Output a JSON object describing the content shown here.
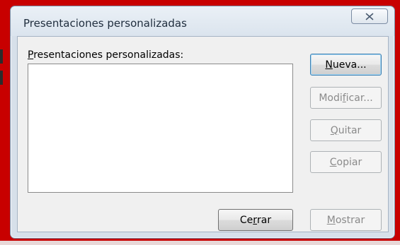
{
  "window": {
    "title": "Presentaciones personalizadas",
    "close_icon": "close-x-icon"
  },
  "list": {
    "label": {
      "before": "",
      "mnemonic": "P",
      "after": "resentaciones personalizadas:"
    },
    "items": []
  },
  "buttons": {
    "new": {
      "before": "",
      "mnemonic": "N",
      "after": "ueva...",
      "enabled": true
    },
    "edit": {
      "before": "Modi",
      "mnemonic": "f",
      "after": "icar...",
      "enabled": false
    },
    "remove": {
      "before": "",
      "mnemonic": "Q",
      "after": "uitar",
      "enabled": false
    },
    "copy": {
      "before": "",
      "mnemonic": "C",
      "after": "opiar",
      "enabled": false
    },
    "close": {
      "before": "Ce",
      "mnemonic": "r",
      "after": "rar",
      "enabled": true
    },
    "show": {
      "before": "",
      "mnemonic": "M",
      "after": "ostrar",
      "enabled": false
    }
  },
  "colors": {
    "outer_highlight": "#c80000",
    "window_frame": "#d7e0ea",
    "client_background": "#f0f0f0"
  }
}
